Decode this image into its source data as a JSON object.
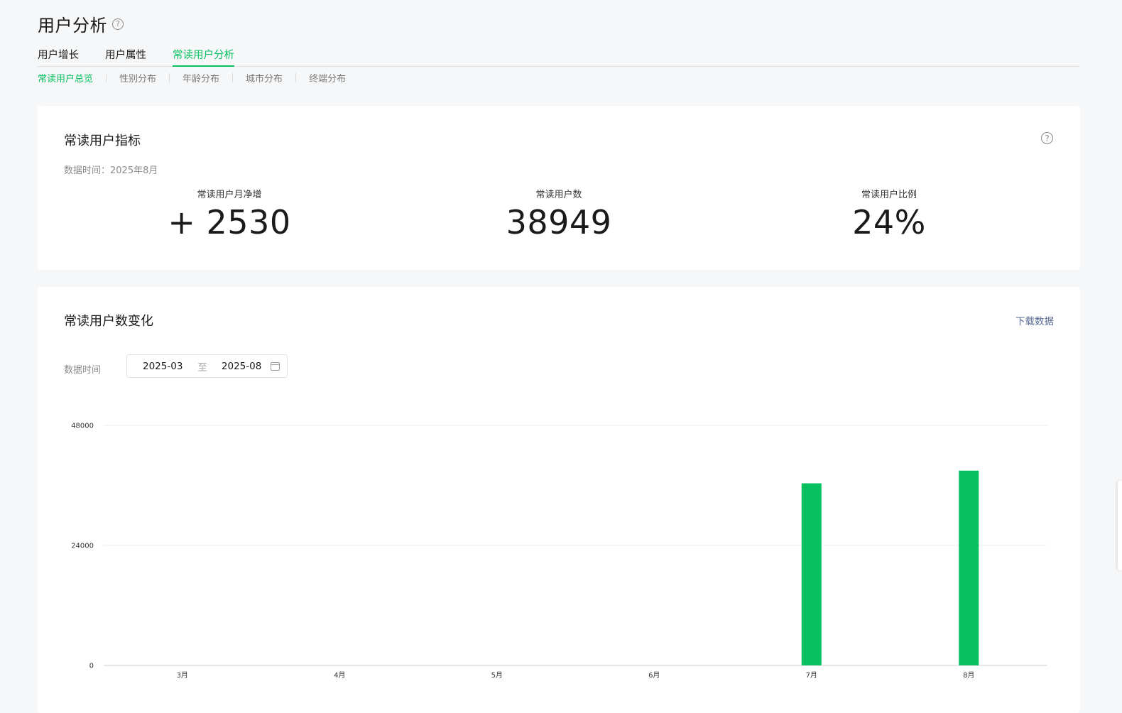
{
  "page": {
    "title": "用户分析"
  },
  "tabs": [
    {
      "label": "用户增长",
      "active": false
    },
    {
      "label": "用户属性",
      "active": false
    },
    {
      "label": "常读用户分析",
      "active": true
    }
  ],
  "subtabs": [
    {
      "label": "常读用户总览",
      "active": true
    },
    {
      "label": "性别分布",
      "active": false
    },
    {
      "label": "年龄分布",
      "active": false
    },
    {
      "label": "城市分布",
      "active": false
    },
    {
      "label": "终端分布",
      "active": false
    }
  ],
  "metrics_card": {
    "title": "常读用户指标",
    "data_time": "数据时间：2025年8月",
    "metrics": [
      {
        "label": "常读用户月净增",
        "value": "+ 2530"
      },
      {
        "label": "常读用户数",
        "value": "38949"
      },
      {
        "label": "常读用户比例",
        "value": "24%"
      }
    ]
  },
  "trend_card": {
    "title": "常读用户数变化",
    "download_label": "下载数据",
    "date_label": "数据时间",
    "date_start": "2025-03",
    "date_sep": "至",
    "date_end": "2025-08"
  },
  "colors": {
    "accent": "#07c160",
    "link": "#576b95"
  },
  "chart_data": {
    "type": "bar",
    "categories": [
      "3月",
      "4月",
      "5月",
      "6月",
      "7月",
      "8月"
    ],
    "values": [
      0,
      0,
      0,
      0,
      36419,
      38949
    ],
    "yticks": [
      0,
      24000,
      48000
    ],
    "ylim": [
      0,
      48000
    ],
    "grid": true,
    "color": "#07c160"
  }
}
